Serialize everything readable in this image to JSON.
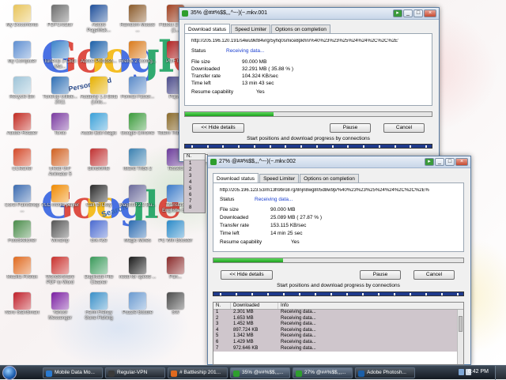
{
  "desktop": {
    "icons": [
      {
        "label": "My Documents",
        "color": "#e8c45a"
      },
      {
        "label": "My Computer",
        "color": "#5f8fd1"
      },
      {
        "label": "Recycle Bin",
        "color": "#9fc4d8"
      },
      {
        "label": "Adobe Reader",
        "color": "#c22b22"
      },
      {
        "label": "CCleaner",
        "color": "#d44a2a"
      },
      {
        "label": "Corel PaintShop ...",
        "color": "#3b6bb0"
      },
      {
        "label": "FotoSketcher",
        "color": "#4a8c4a"
      },
      {
        "label": "Mozilla Firefox",
        "color": "#e06a1f"
      },
      {
        "label": "Nero StartSmart",
        "color": "#c0202a"
      },
      {
        "label": "PDFCreator",
        "color": "#6c6c6c"
      },
      {
        "label": "TuneUp 1-Click Mai...",
        "color": "#3a82c9"
      },
      {
        "label": "TuneUp Utilitie... 2011",
        "color": "#2e6fb5"
      },
      {
        "label": "Tortlo",
        "color": "#7a3aa0"
      },
      {
        "label": "Ulead GIF Animator 5",
        "color": "#d06020"
      },
      {
        "label": "VLC media player",
        "color": "#f08a00"
      },
      {
        "label": "Winamp",
        "color": "#555555"
      },
      {
        "label": "Wondershare PDF to Word",
        "color": "#c9302c"
      },
      {
        "label": "Yahoo! Messenger",
        "color": "#7b1fa2"
      },
      {
        "label": "Adobe PageMak...",
        "color": "#1f4f9a"
      },
      {
        "label": "Adobe Photosh...",
        "color": "#1b5fa8"
      },
      {
        "label": "Audacity 1.3 Beta (Unic...",
        "color": "#e6b000"
      },
      {
        "label": "Audio Edit Magic",
        "color": "#3aa0d8"
      },
      {
        "label": "BlindWrite",
        "color": "#c03030"
      },
      {
        "label": "Call Of Duty",
        "color": "#2a2a2a"
      },
      {
        "label": "Gfx Ace",
        "color": "#4a6ad0"
      },
      {
        "label": "Duplicate File Cleaner",
        "color": "#3a9a5a"
      },
      {
        "label": "Farm Frenzy Gone Fishing",
        "color": "#3a90c8"
      },
      {
        "label": "Ramdom Mouse ...",
        "color": "#8a5a2a"
      },
      {
        "label": "Firefox 2 Config...",
        "color": "#d97a1a"
      },
      {
        "label": "Format Factor...",
        "color": "#5a8ac8"
      },
      {
        "label": "Google Chrome",
        "color": "#3a9a3a"
      },
      {
        "label": "Island Tribe 2",
        "color": "#3a80b0"
      },
      {
        "label": "Magicbit 2.2 Bu...",
        "color": "#6a6a9a"
      },
      {
        "label": "Magic Mines",
        "color": "#2a6ab0"
      },
      {
        "label": "need for speed ...",
        "color": "#1a1a1a"
      },
      {
        "label": "Puzzle Bubble",
        "color": "#6a9ad0"
      },
      {
        "label": "Flatout 2 Game (1...",
        "color": "#a04020"
      },
      {
        "label": "PDF to...",
        "color": "#b02020"
      },
      {
        "label": "Pajs...",
        "color": "#4a4a8a"
      },
      {
        "label": "Totem Tribe Gold",
        "color": "#8a6a2a"
      },
      {
        "label": "Tessel3",
        "color": "#6a3a9a"
      },
      {
        "label": "Translate Englishe E...",
        "color": "#3a7ac8"
      },
      {
        "label": "PC Win Booster",
        "color": "#2a8ac8"
      },
      {
        "label": "Pan...",
        "color": "#8a2a2a"
      },
      {
        "label": "SW",
        "color": "#4a4a4a"
      }
    ],
    "google_text": "Google",
    "personalized_text": "Personalized",
    "search_text": "Search"
  },
  "window1": {
    "title": "35% @##%$$,,,^~-)(~.mkv.001",
    "tabs": [
      "Download status",
      "Speed Limiter",
      "Options on completion"
    ],
    "active_tab": 0,
    "url": "http://205.196.120.191/s4wu9kf84vrg/5yhq0smice8pkhn/%40%23%23%25%24%24%2C%2C%2E'",
    "status_label": "Status",
    "status_value": "Receiving data...",
    "file_size_label": "File size",
    "file_size": "90.000  MB",
    "downloaded_label": "Downloaded",
    "downloaded": "32.291  MB  ( 35.88 % )",
    "transfer_rate_label": "Transfer rate",
    "transfer_rate": "104.324  KB/sec",
    "time_left_label": "Time left",
    "time_left": "13 min 43 sec",
    "resume_label": "Resume capability",
    "resume_value": "Yes",
    "progress": 0.3588,
    "hide_details": "<< Hide details",
    "pause": "Pause",
    "cancel": "Cancel",
    "connections_caption": "Start positions and download progress by connections",
    "grid_numbers": [
      "1",
      "2",
      "3",
      "4",
      "5",
      "6",
      "7",
      "8"
    ]
  },
  "window2": {
    "title": "27% @##%$$,,,^~-)(~.mkv.002",
    "tabs": [
      "Download status",
      "Speed Limiter",
      "Options on completion"
    ],
    "active_tab": 0,
    "url": "http://205.196.123.53/m13h9bro87g/8njn8wg805d8w9p/%40%23%23%25%24%24%2C%2C%2E%",
    "status_label": "Status",
    "status_value": "Receiving data...",
    "file_size_label": "File size",
    "file_size": "90.000  MB",
    "downloaded_label": "Downloaded",
    "downloaded": "25.089  MB  ( 27.87 % )",
    "transfer_rate_label": "Transfer rate",
    "transfer_rate": "153.115  KB/sec",
    "time_left_label": "Time left",
    "time_left": "14 min 25 sec",
    "resume_label": "Resume capability",
    "resume_value": "Yes",
    "progress": 0.2787,
    "hide_details": "<< Hide details",
    "pause": "Pause",
    "cancel": "Cancel",
    "connections_caption": "Start positions and download progress by connections",
    "grid_headers": [
      "N.",
      "Downloaded",
      "Info"
    ],
    "grid_rows": [
      {
        "n": "1",
        "downloaded": "2.301  MB",
        "info": "Receiving data..."
      },
      {
        "n": "2",
        "downloaded": "1.653  MB",
        "info": "Receiving data..."
      },
      {
        "n": "3",
        "downloaded": "1.452  MB",
        "info": "Receiving data..."
      },
      {
        "n": "4",
        "downloaded": "897.724  KB",
        "info": "Receiving data..."
      },
      {
        "n": "5",
        "downloaded": "1.342  MB",
        "info": "Receiving data..."
      },
      {
        "n": "6",
        "downloaded": "1.429  MB",
        "info": "Receiving data..."
      },
      {
        "n": "7",
        "downloaded": "972.646  KB",
        "info": "Receiving data..."
      }
    ]
  },
  "taskbar": {
    "items": [
      {
        "label": "Mobile Data Mo...",
        "color": "#2a7ad0"
      },
      {
        "label": "Regular-VPN",
        "color": "#3a3a3a"
      },
      {
        "label": "# Battleship 201...",
        "color": "#e06a1f"
      },
      {
        "label": "35% @##%$$,,,...",
        "color": "#2e9e2e"
      },
      {
        "label": "27% @##%$$,,,...",
        "color": "#2e9e2e"
      },
      {
        "label": "Adobe Photosh...",
        "color": "#1b5fa8"
      }
    ],
    "clock": "6:42 PM"
  }
}
